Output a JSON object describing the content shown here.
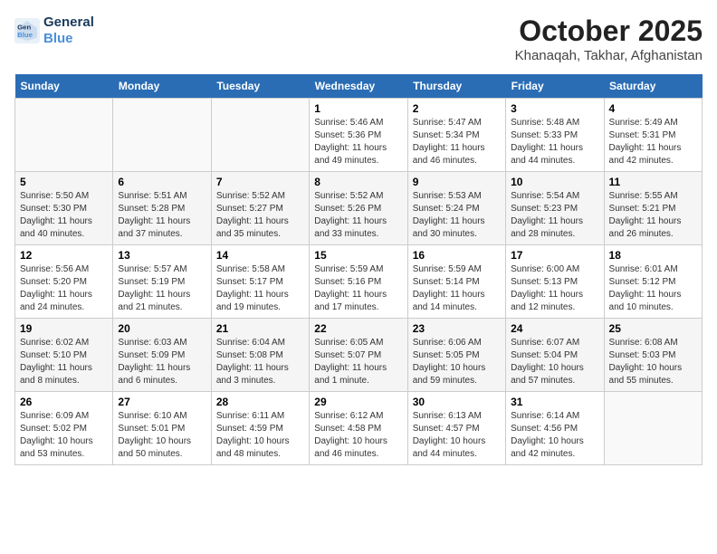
{
  "header": {
    "logo_line1": "General",
    "logo_line2": "Blue",
    "title": "October 2025",
    "subtitle": "Khanaqah, Takhar, Afghanistan"
  },
  "weekdays": [
    "Sunday",
    "Monday",
    "Tuesday",
    "Wednesday",
    "Thursday",
    "Friday",
    "Saturday"
  ],
  "weeks": [
    [
      {
        "day": "",
        "info": ""
      },
      {
        "day": "",
        "info": ""
      },
      {
        "day": "",
        "info": ""
      },
      {
        "day": "1",
        "info": "Sunrise: 5:46 AM\nSunset: 5:36 PM\nDaylight: 11 hours\nand 49 minutes."
      },
      {
        "day": "2",
        "info": "Sunrise: 5:47 AM\nSunset: 5:34 PM\nDaylight: 11 hours\nand 46 minutes."
      },
      {
        "day": "3",
        "info": "Sunrise: 5:48 AM\nSunset: 5:33 PM\nDaylight: 11 hours\nand 44 minutes."
      },
      {
        "day": "4",
        "info": "Sunrise: 5:49 AM\nSunset: 5:31 PM\nDaylight: 11 hours\nand 42 minutes."
      }
    ],
    [
      {
        "day": "5",
        "info": "Sunrise: 5:50 AM\nSunset: 5:30 PM\nDaylight: 11 hours\nand 40 minutes."
      },
      {
        "day": "6",
        "info": "Sunrise: 5:51 AM\nSunset: 5:28 PM\nDaylight: 11 hours\nand 37 minutes."
      },
      {
        "day": "7",
        "info": "Sunrise: 5:52 AM\nSunset: 5:27 PM\nDaylight: 11 hours\nand 35 minutes."
      },
      {
        "day": "8",
        "info": "Sunrise: 5:52 AM\nSunset: 5:26 PM\nDaylight: 11 hours\nand 33 minutes."
      },
      {
        "day": "9",
        "info": "Sunrise: 5:53 AM\nSunset: 5:24 PM\nDaylight: 11 hours\nand 30 minutes."
      },
      {
        "day": "10",
        "info": "Sunrise: 5:54 AM\nSunset: 5:23 PM\nDaylight: 11 hours\nand 28 minutes."
      },
      {
        "day": "11",
        "info": "Sunrise: 5:55 AM\nSunset: 5:21 PM\nDaylight: 11 hours\nand 26 minutes."
      }
    ],
    [
      {
        "day": "12",
        "info": "Sunrise: 5:56 AM\nSunset: 5:20 PM\nDaylight: 11 hours\nand 24 minutes."
      },
      {
        "day": "13",
        "info": "Sunrise: 5:57 AM\nSunset: 5:19 PM\nDaylight: 11 hours\nand 21 minutes."
      },
      {
        "day": "14",
        "info": "Sunrise: 5:58 AM\nSunset: 5:17 PM\nDaylight: 11 hours\nand 19 minutes."
      },
      {
        "day": "15",
        "info": "Sunrise: 5:59 AM\nSunset: 5:16 PM\nDaylight: 11 hours\nand 17 minutes."
      },
      {
        "day": "16",
        "info": "Sunrise: 5:59 AM\nSunset: 5:14 PM\nDaylight: 11 hours\nand 14 minutes."
      },
      {
        "day": "17",
        "info": "Sunrise: 6:00 AM\nSunset: 5:13 PM\nDaylight: 11 hours\nand 12 minutes."
      },
      {
        "day": "18",
        "info": "Sunrise: 6:01 AM\nSunset: 5:12 PM\nDaylight: 11 hours\nand 10 minutes."
      }
    ],
    [
      {
        "day": "19",
        "info": "Sunrise: 6:02 AM\nSunset: 5:10 PM\nDaylight: 11 hours\nand 8 minutes."
      },
      {
        "day": "20",
        "info": "Sunrise: 6:03 AM\nSunset: 5:09 PM\nDaylight: 11 hours\nand 6 minutes."
      },
      {
        "day": "21",
        "info": "Sunrise: 6:04 AM\nSunset: 5:08 PM\nDaylight: 11 hours\nand 3 minutes."
      },
      {
        "day": "22",
        "info": "Sunrise: 6:05 AM\nSunset: 5:07 PM\nDaylight: 11 hours\nand 1 minute."
      },
      {
        "day": "23",
        "info": "Sunrise: 6:06 AM\nSunset: 5:05 PM\nDaylight: 10 hours\nand 59 minutes."
      },
      {
        "day": "24",
        "info": "Sunrise: 6:07 AM\nSunset: 5:04 PM\nDaylight: 10 hours\nand 57 minutes."
      },
      {
        "day": "25",
        "info": "Sunrise: 6:08 AM\nSunset: 5:03 PM\nDaylight: 10 hours\nand 55 minutes."
      }
    ],
    [
      {
        "day": "26",
        "info": "Sunrise: 6:09 AM\nSunset: 5:02 PM\nDaylight: 10 hours\nand 53 minutes."
      },
      {
        "day": "27",
        "info": "Sunrise: 6:10 AM\nSunset: 5:01 PM\nDaylight: 10 hours\nand 50 minutes."
      },
      {
        "day": "28",
        "info": "Sunrise: 6:11 AM\nSunset: 4:59 PM\nDaylight: 10 hours\nand 48 minutes."
      },
      {
        "day": "29",
        "info": "Sunrise: 6:12 AM\nSunset: 4:58 PM\nDaylight: 10 hours\nand 46 minutes."
      },
      {
        "day": "30",
        "info": "Sunrise: 6:13 AM\nSunset: 4:57 PM\nDaylight: 10 hours\nand 44 minutes."
      },
      {
        "day": "31",
        "info": "Sunrise: 6:14 AM\nSunset: 4:56 PM\nDaylight: 10 hours\nand 42 minutes."
      },
      {
        "day": "",
        "info": ""
      }
    ]
  ]
}
